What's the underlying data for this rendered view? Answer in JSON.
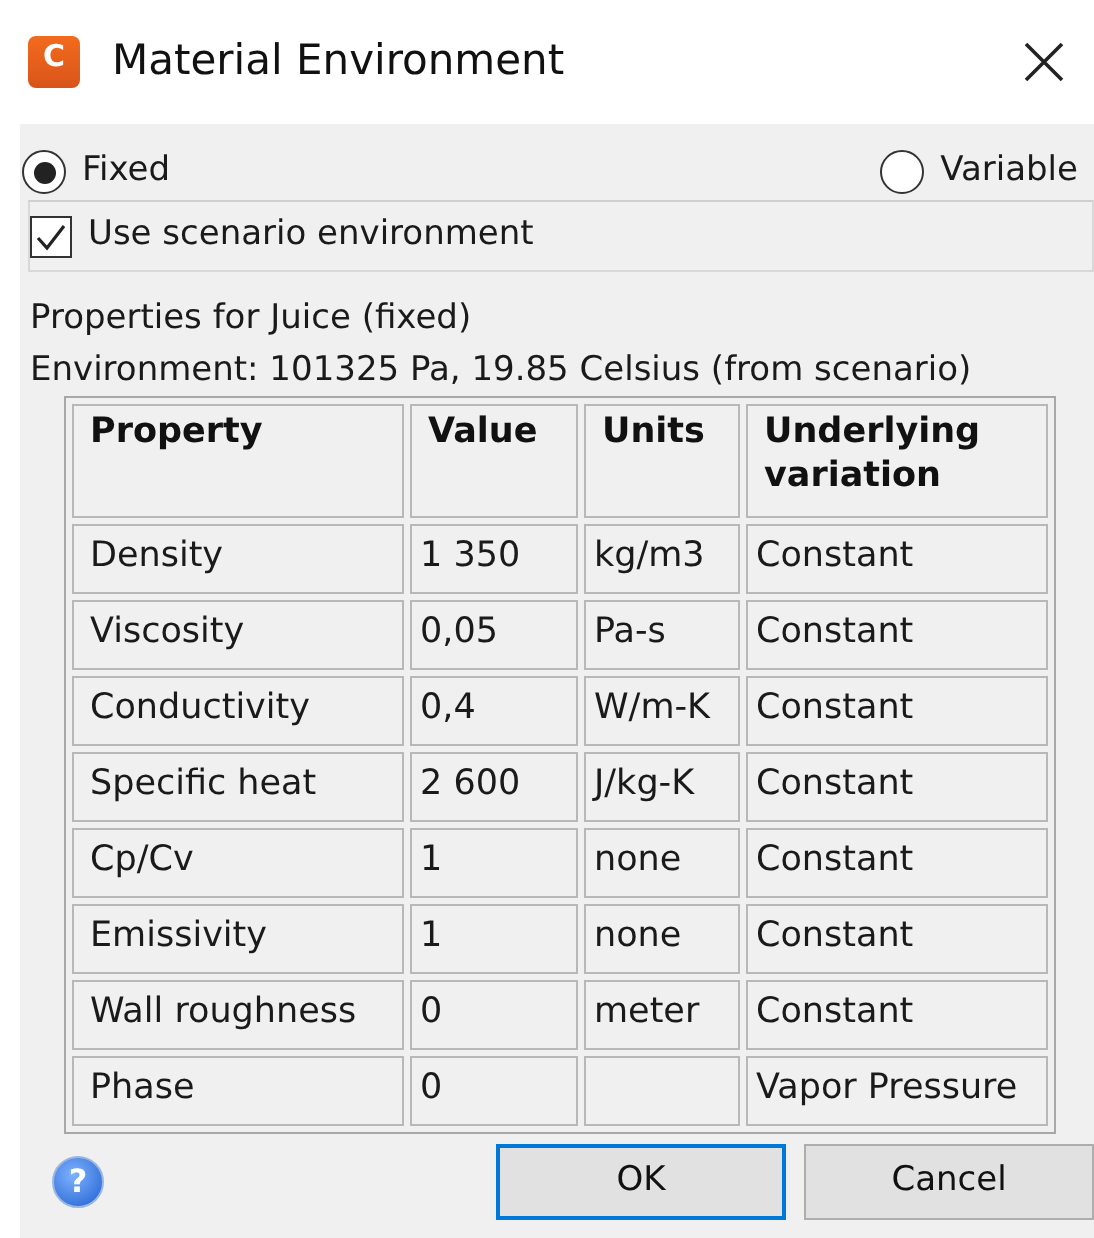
{
  "window": {
    "title": "Material Environment",
    "app_icon_letter": "C"
  },
  "mode_options": [
    {
      "label": "Fixed",
      "selected": true
    },
    {
      "label": "Variable",
      "selected": false
    }
  ],
  "use_scenario_environment": {
    "label": "Use scenario environment",
    "checked": true
  },
  "info_lines": [
    "Properties for Juice (fixed)",
    "Environment: 101325 Pa, 19.85 Celsius (from scenario)"
  ],
  "table": {
    "columns": [
      "Property",
      "Value",
      "Units",
      "Underlying variation"
    ],
    "rows": [
      [
        "Density",
        "1 350",
        "kg/m3",
        "Constant"
      ],
      [
        "Viscosity",
        "0,05",
        "Pa-s",
        "Constant"
      ],
      [
        "Conductivity",
        "0,4",
        "W/m-K",
        "Constant"
      ],
      [
        "Specific heat",
        "2 600",
        "J/kg-K",
        "Constant"
      ],
      [
        "Cp/Cv",
        "1",
        "none",
        "Constant"
      ],
      [
        "Emissivity",
        "1",
        "none",
        "Constant"
      ],
      [
        "Wall roughness",
        "0",
        "meter",
        "Constant"
      ],
      [
        "Phase",
        "0",
        "",
        "Vapor Pressure"
      ]
    ]
  },
  "help": {
    "glyph": "?"
  },
  "buttons": [
    {
      "label": "OK",
      "default": true
    },
    {
      "label": "Cancel",
      "default": false
    }
  ]
}
